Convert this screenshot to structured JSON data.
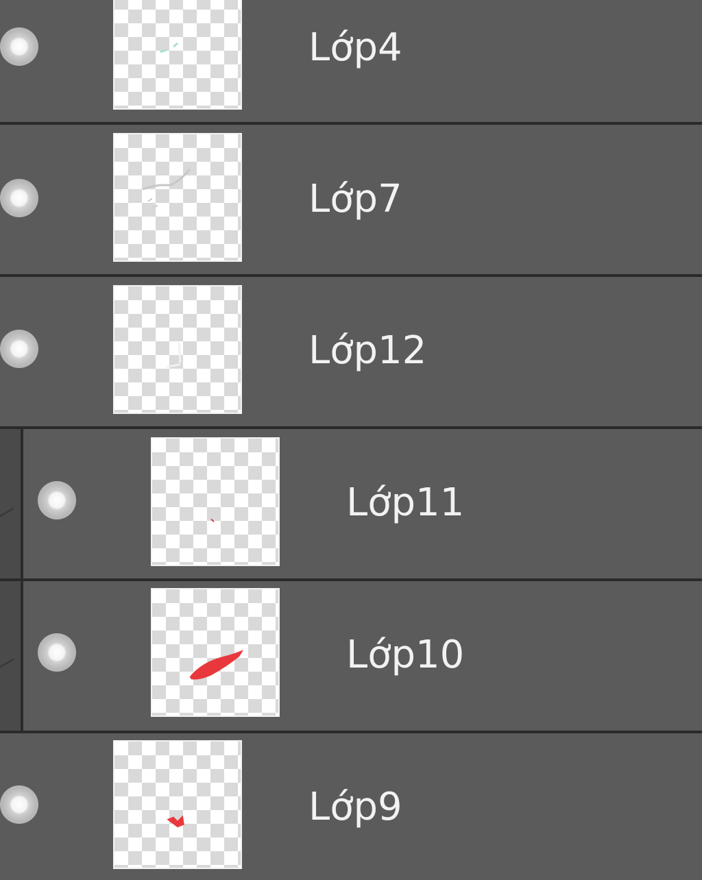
{
  "layers_panel": {
    "layers": [
      {
        "name": "Lớp4",
        "visible": true,
        "thumbnail": "faint-green-marks"
      },
      {
        "name": "Lớp7",
        "visible": true,
        "thumbnail": "faint-gray-sketch"
      },
      {
        "name": "Lớp12",
        "visible": true,
        "thumbnail": "faint-white-marks"
      },
      {
        "name": "Lớp11",
        "visible": true,
        "thumbnail": "tiny-red-dot",
        "clipped_child": true
      },
      {
        "name": "Lớp10",
        "visible": true,
        "thumbnail": "red-brush-stroke",
        "clipped_child": true
      },
      {
        "name": "Lớp9",
        "visible": true,
        "thumbnail": "small-red-mark"
      }
    ],
    "colors": {
      "panel_bg": "#5b5b5b",
      "separator": "#2a2a2a",
      "label_text": "#f2f2f2",
      "accent_red": "#e8383d"
    },
    "icons": {
      "visibility": "eye-icon"
    }
  }
}
